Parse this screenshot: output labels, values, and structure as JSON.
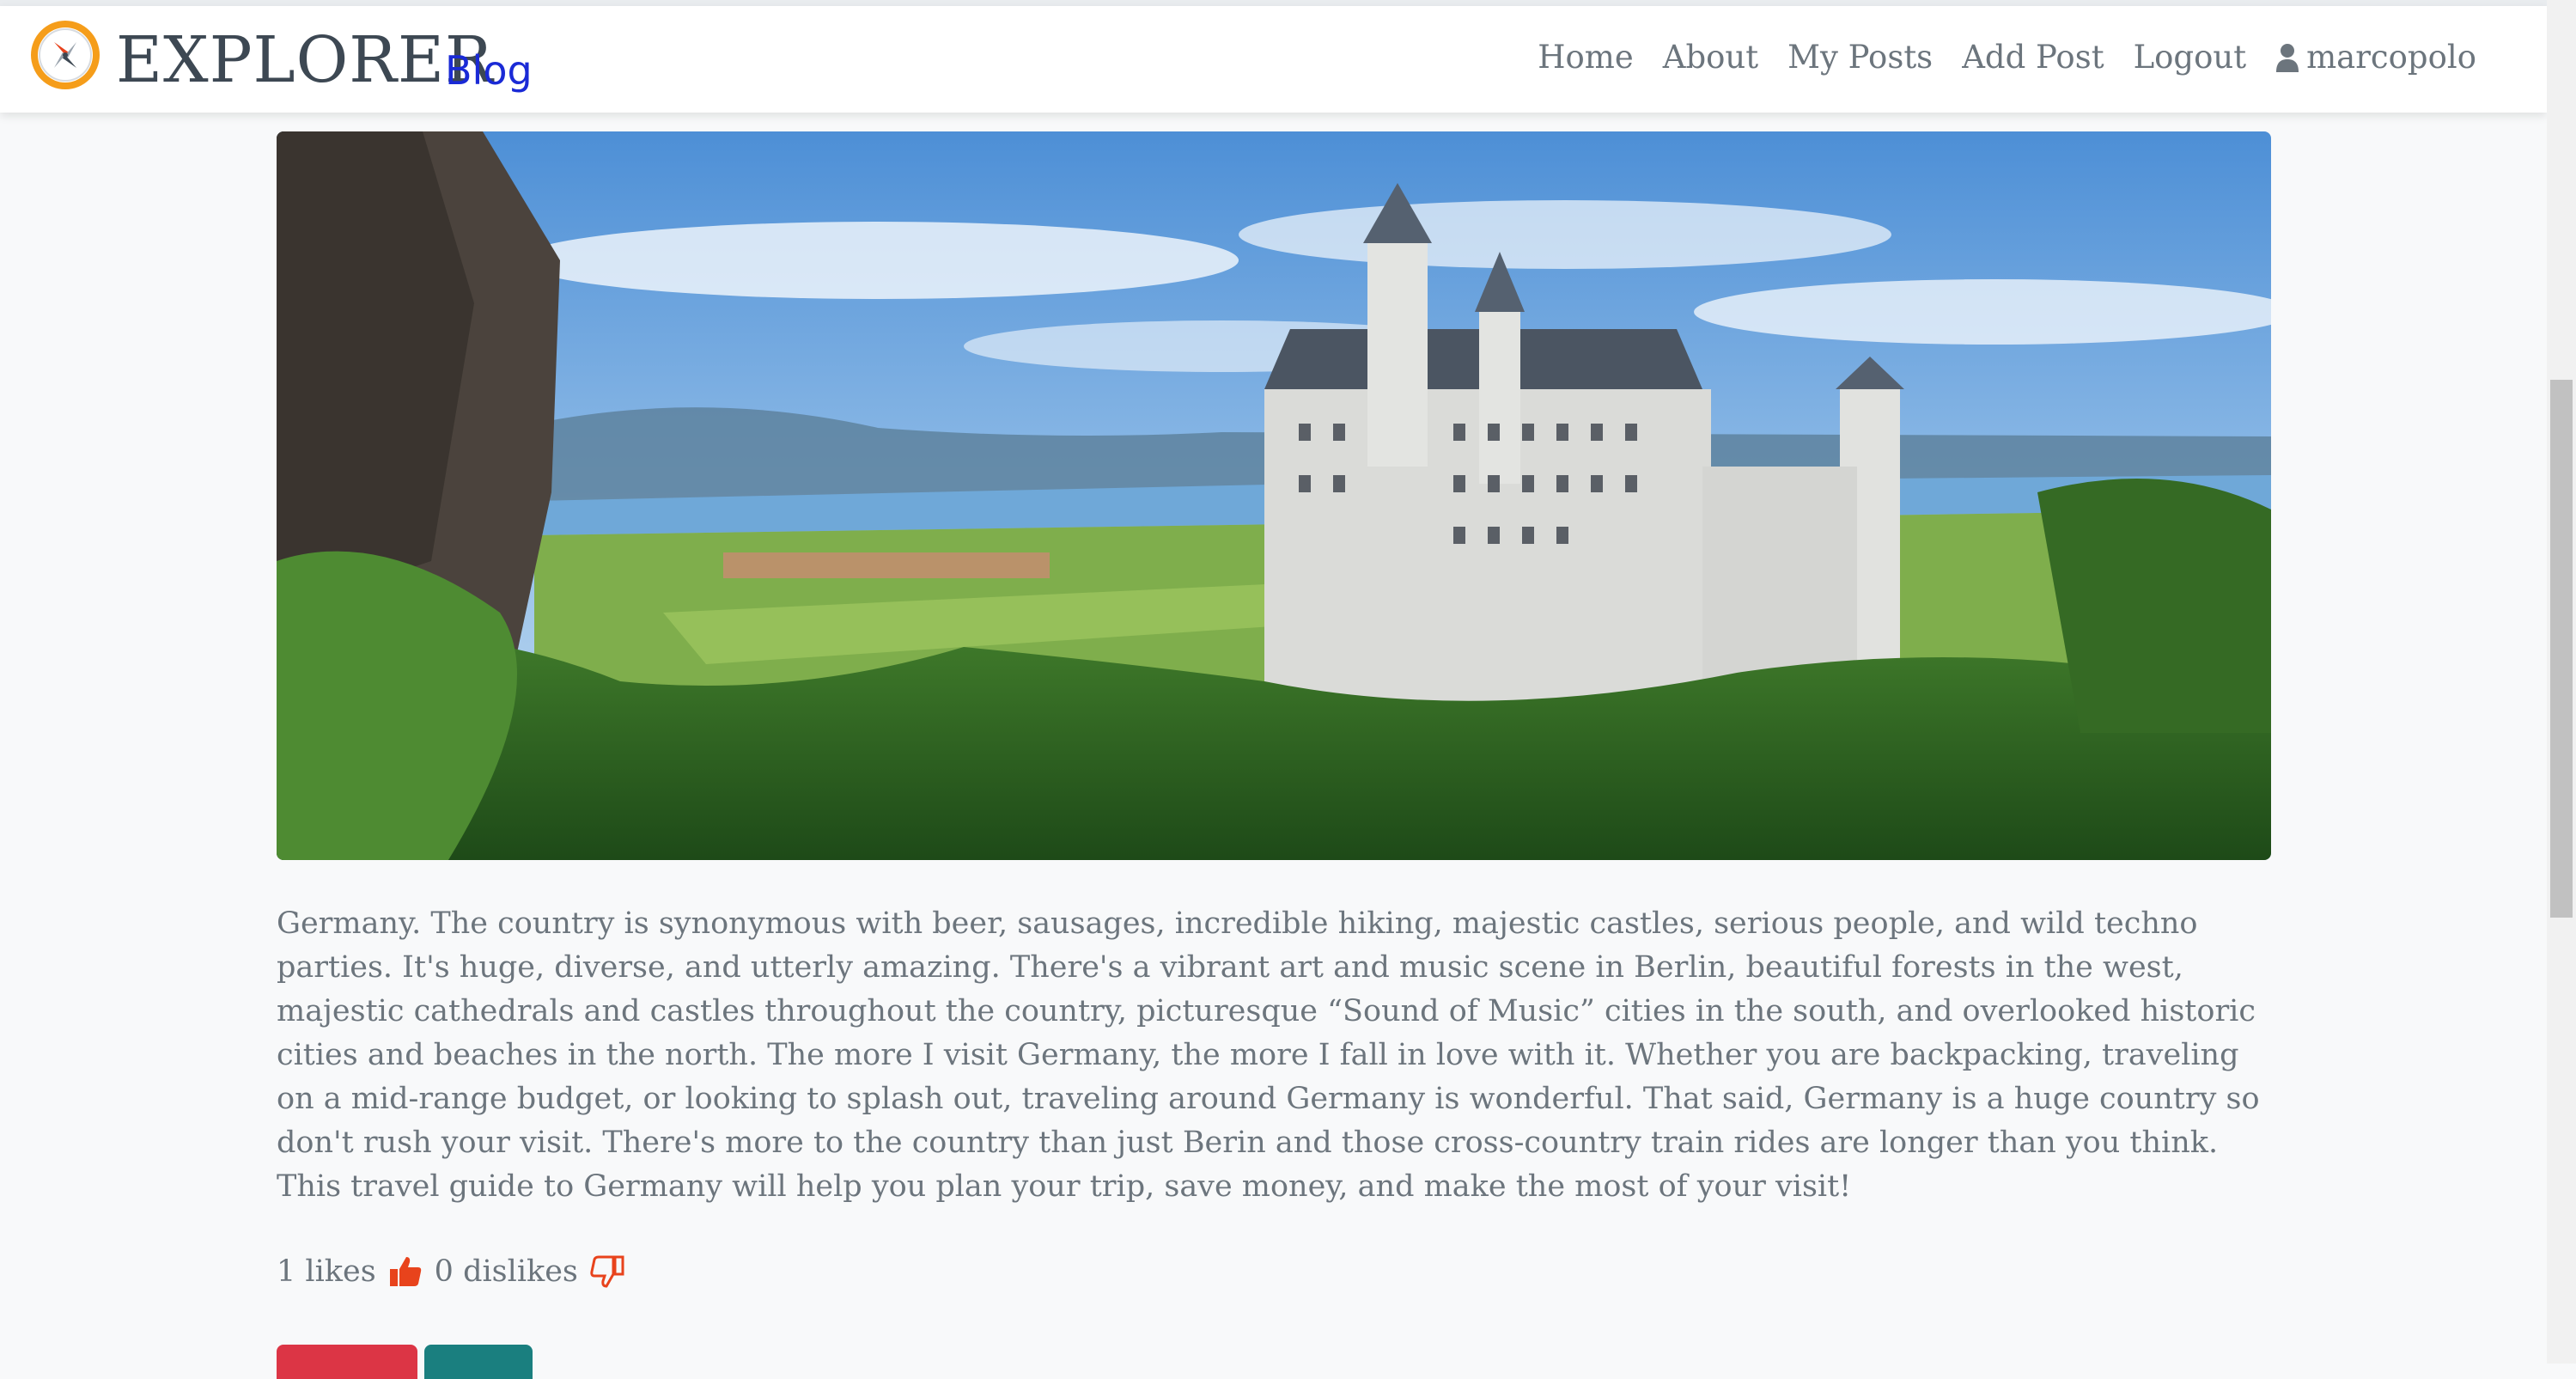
{
  "brand": {
    "name": "EXPLORER",
    "sub": "Blog"
  },
  "nav": {
    "home": "Home",
    "about": "About",
    "my_posts": "My Posts",
    "add_post": "Add Post",
    "logout": "Logout",
    "username": "marcopolo"
  },
  "post": {
    "body": "Germany. The country is synonymous with beer, sausages, incredible hiking, majestic castles, serious people, and wild techno parties. It's huge, diverse, and utterly amazing. There's a vibrant art and music scene in Berlin, beautiful forests in the west, majestic cathedrals and castles throughout the country, picturesque “Sound of Music” cities in the south, and overlooked historic cities and beaches in the north. The more I visit Germany, the more I fall in love with it. Whether you are backpacking, traveling on a mid-range budget, or looking to splash out, traveling around Germany is wonderful. That said, Germany is a huge country so don't rush your visit. There's more to the country than just Berin and those cross-country train rides are longer than you think. This travel guide to Germany will help you plan your trip, save money, and make the most of your visit!",
    "likes_label": "1 likes",
    "dislikes_label": "0 dislikes"
  },
  "colors": {
    "brand_blue": "#1a2ad6",
    "reaction_orange": "#e8431c",
    "danger": "#dc3545",
    "teal": "#1a7f7f"
  },
  "icons": {
    "logo": "compass-icon",
    "user": "user-icon",
    "like": "thumbs-up-icon",
    "dislike": "thumbs-down-icon"
  }
}
